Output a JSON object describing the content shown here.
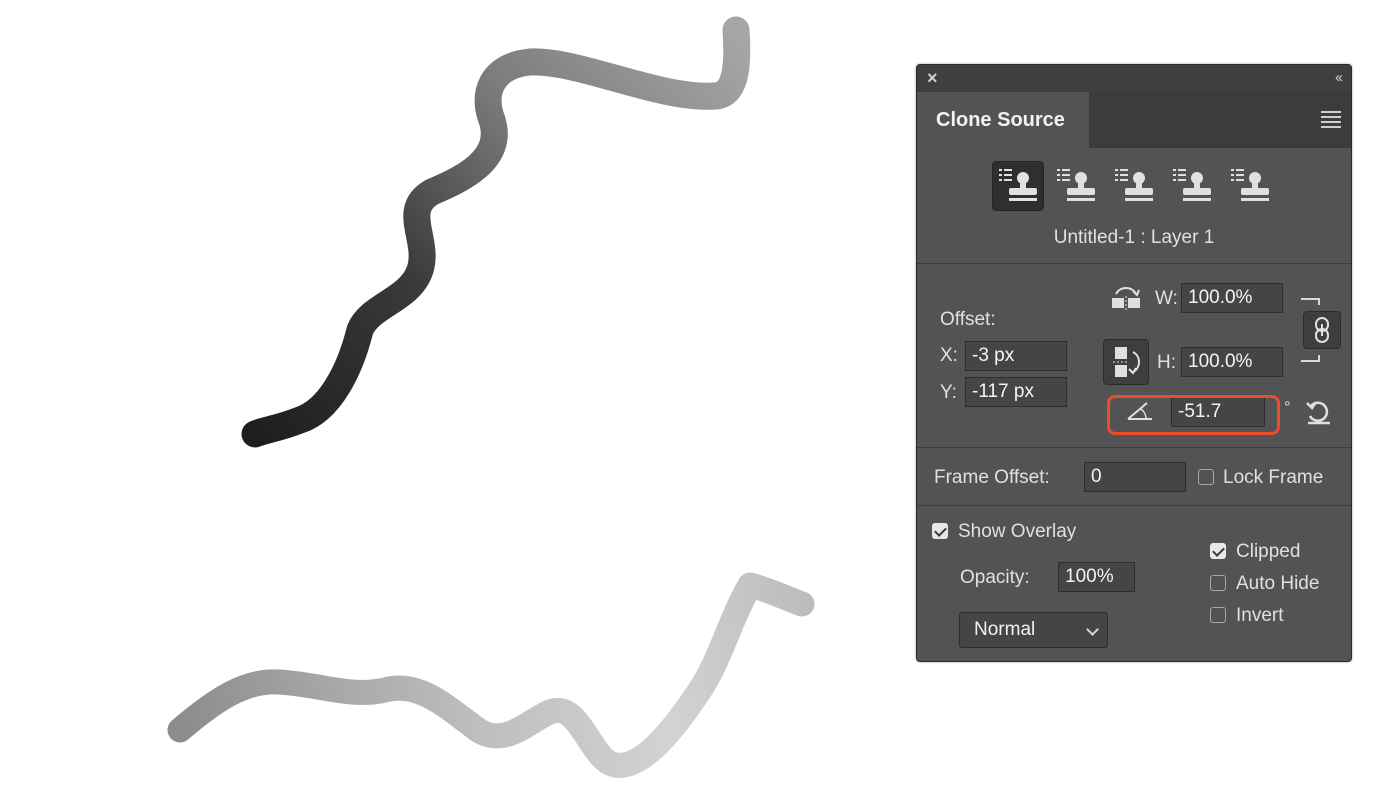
{
  "panel": {
    "tab_title": "Clone Source",
    "close_glyph": "×",
    "collapse_glyph": "‹‹",
    "source_name": "Untitled-1 : Layer 1",
    "clone_sources": [
      {
        "icon": "clone-stamp-icon",
        "active": true
      },
      {
        "icon": "clone-stamp-icon",
        "active": false
      },
      {
        "icon": "clone-stamp-icon",
        "active": false
      },
      {
        "icon": "clone-stamp-icon",
        "active": false
      },
      {
        "icon": "clone-stamp-icon",
        "active": false
      }
    ]
  },
  "offset": {
    "label": "Offset:",
    "x_label": "X:",
    "x_value": "-3 px",
    "y_label": "Y:",
    "y_value": "-117 px",
    "w_label": "W:",
    "w_value": "100.0%",
    "h_label": "H:",
    "h_value": "100.0%",
    "angle_value": "-51.7",
    "degree_symbol": "°"
  },
  "frame": {
    "label": "Frame Offset:",
    "value": "0",
    "lock_label": "Lock Frame",
    "lock_checked": false
  },
  "overlay": {
    "show_label": "Show Overlay",
    "show_checked": true,
    "opacity_label": "Opacity:",
    "opacity_value": "100%",
    "blend_mode": "Normal",
    "clipped_label": "Clipped",
    "clipped_checked": true,
    "auto_hide_label": "Auto Hide",
    "auto_hide_checked": false,
    "invert_label": "Invert",
    "invert_checked": false
  },
  "colors": {
    "panel_bg": "#535353",
    "highlight": "#ea4d27"
  }
}
